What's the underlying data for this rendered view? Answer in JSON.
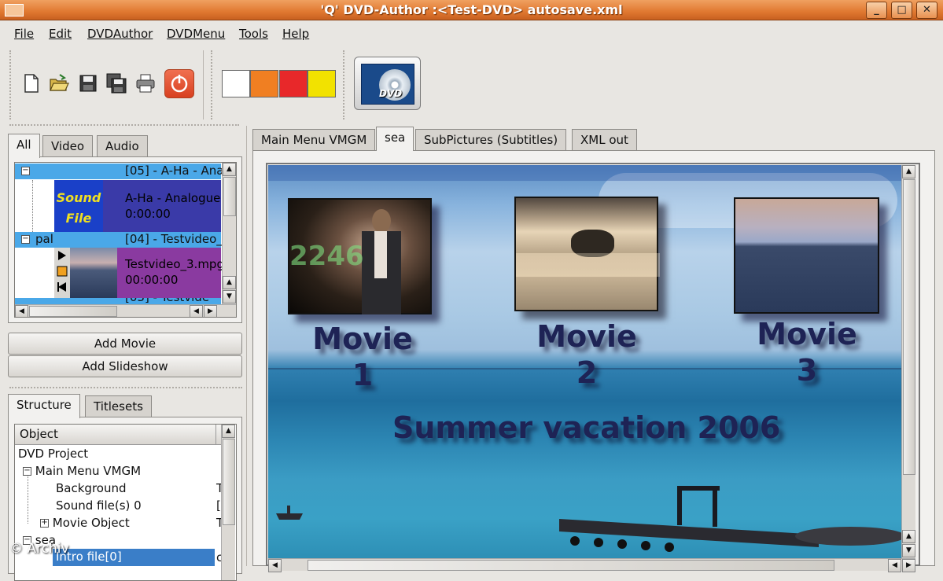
{
  "window": {
    "title": "'Q' DVD-Author :<Test-DVD> autosave.xml",
    "buttons": [
      "_",
      "□",
      "✕"
    ]
  },
  "menubar": {
    "items": [
      {
        "label": "File"
      },
      {
        "label": "Edit"
      },
      {
        "label": "DVDAuthor"
      },
      {
        "label": "DVDMenu"
      },
      {
        "label": "Tools"
      },
      {
        "label": "Help"
      }
    ]
  },
  "toolbar": {
    "icons": [
      "new-file-icon",
      "open-folder-icon",
      "save-icon",
      "save-all-icon",
      "print-icon",
      "power-icon"
    ],
    "colors": [
      "#ffffff",
      "#f07f22",
      "#e8282a",
      "#f2e200"
    ],
    "dvd_button_label": "DVD"
  },
  "source_panel": {
    "tabs": [
      "All",
      "Video",
      "Audio"
    ],
    "active_tab": "All",
    "entries": [
      {
        "header_label": "[05] - A-Ha - Ana",
        "thumb_text_line1": "Sound",
        "thumb_text_line2": "File",
        "name": "A-Ha - Analogue",
        "duration": "0:00:00",
        "header_color": "#4aa8e8",
        "body_color": "#3a3aa8"
      },
      {
        "header_prefix": "pal",
        "header_label": "[04] - Testvideo_",
        "name": "Testvideo_3.mpg",
        "duration": "00:00:00",
        "header_color": "#4aa8e8",
        "body_color": "#8a3aa0"
      }
    ],
    "partial_entry": "[03] - Testvide"
  },
  "buttons": {
    "add_movie": "Add Movie",
    "add_slideshow": "Add Slideshow"
  },
  "structure_panel": {
    "tabs": [
      "Structure",
      "Titlesets"
    ],
    "active_tab": "Structure",
    "column_header": "Object",
    "rows": [
      {
        "label": "DVD Project",
        "indent": 0,
        "expander": ""
      },
      {
        "label": "Main Menu VMGM",
        "indent": 1,
        "expander": "−"
      },
      {
        "label": "Background",
        "indent": 2,
        "expander": "",
        "right": "T"
      },
      {
        "label": "Sound file(s) 0",
        "indent": 2,
        "expander": "",
        "right": "["
      },
      {
        "label": "Movie Object",
        "indent": 2,
        "expander": "+",
        "right": "T"
      },
      {
        "label": "sea",
        "indent": 0,
        "expander": "−"
      },
      {
        "label": "Intro file[0]",
        "indent": 2,
        "expander": "",
        "right": "c",
        "selected": true
      }
    ]
  },
  "main_tabs": {
    "tabs": [
      "Main Menu VMGM",
      "sea",
      "SubPictures (Subtitles)",
      "XML out"
    ],
    "active_tab": "sea"
  },
  "menu_preview": {
    "movies": [
      {
        "line1": "Movie",
        "line2": "1"
      },
      {
        "line1": "Movie",
        "line2": "2"
      },
      {
        "line1": "Movie",
        "line2": "3"
      }
    ],
    "title": "Summer vacation 2006",
    "thumb1_text": "2246"
  },
  "watermark": "© Archiv"
}
